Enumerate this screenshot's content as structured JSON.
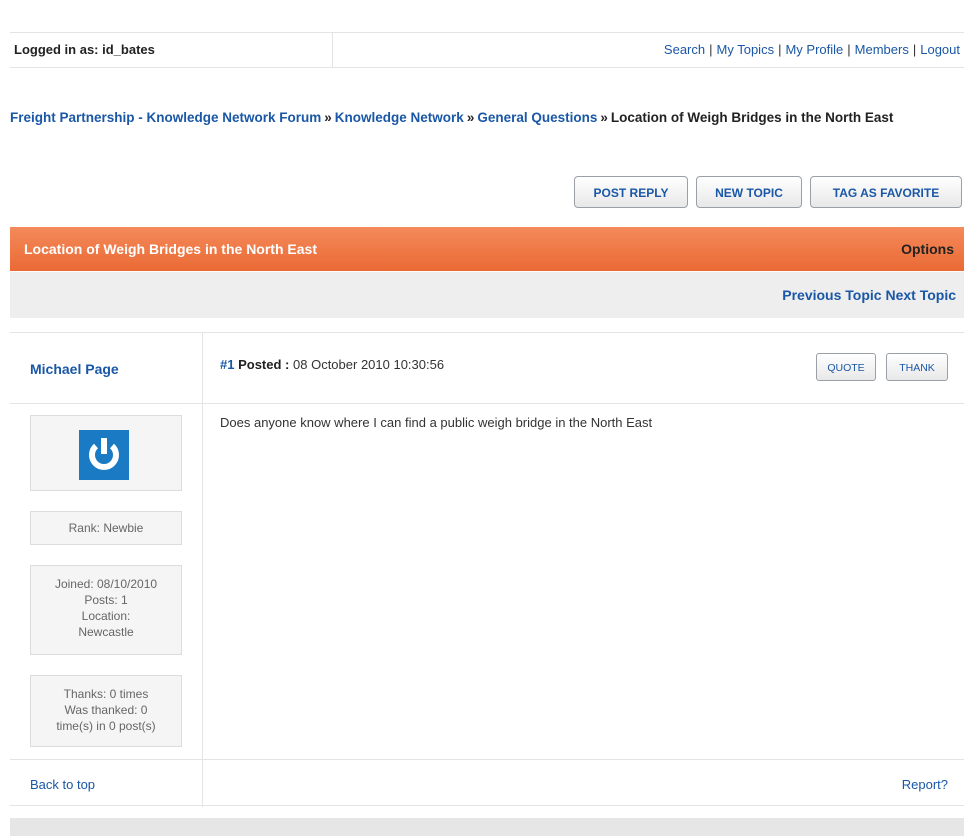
{
  "login": {
    "text": "Logged in as: id_bates",
    "links": [
      "Search",
      "My Topics",
      "My Profile",
      "Members",
      "Logout"
    ]
  },
  "breadcrumb": {
    "items": [
      "Freight Partnership - Knowledge Network Forum",
      "Knowledge Network",
      "General Questions"
    ],
    "separator": "»",
    "current": "Location of Weigh Bridges in the North East"
  },
  "actions": {
    "post_reply": "POST REPLY",
    "new_topic": "NEW TOPIC",
    "tag_favorite": "TAG AS FAVORITE"
  },
  "topic": {
    "title": "Location of Weigh Bridges in the North East",
    "options": "Options",
    "previous": "Previous Topic",
    "next": "Next Topic"
  },
  "post": {
    "author": "Michael Page",
    "number": "#1",
    "posted_label": "Posted :",
    "posted_date": "08 October 2010 10:30:56",
    "quote": "QUOTE",
    "thank": "THANK",
    "rank": "Rank: Newbie",
    "joined": "Joined: 08/10/2010",
    "posts": "Posts: 1",
    "location_label": "Location:",
    "location": "Newcastle",
    "thanks_given": "Thanks: 0 times",
    "was_thanked": "Was thanked: 0",
    "thanked_detail": "time(s) in 0 post(s)",
    "message": "Does anyone know where I can find a public weigh bridge in the North East",
    "back_to_top": "Back to top",
    "report": "Report?"
  },
  "icons": {
    "avatar": "power-icon"
  },
  "colors": {
    "header_orange": "#ea6a35",
    "link_blue": "#1a57a6",
    "avatar_blue": "#1a7ac3"
  }
}
